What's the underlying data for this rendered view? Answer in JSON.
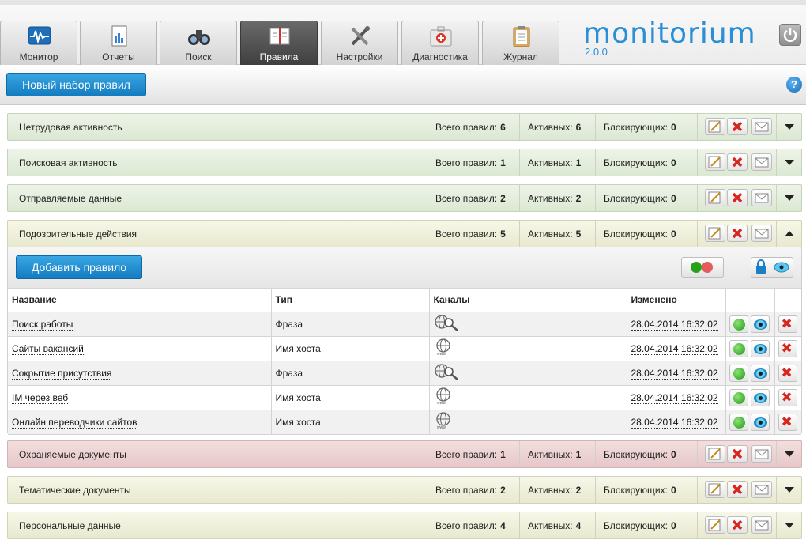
{
  "tabs": [
    {
      "label": "Монитор",
      "icon": "monitor-icon",
      "active": false
    },
    {
      "label": "Отчеты",
      "icon": "reports-icon",
      "active": false
    },
    {
      "label": "Поиск",
      "icon": "binoculars-icon",
      "active": false
    },
    {
      "label": "Правила",
      "icon": "notebook-icon",
      "active": true
    },
    {
      "label": "Настройки",
      "icon": "tools-icon",
      "active": false
    },
    {
      "label": "Диагностика",
      "icon": "firstaid-icon",
      "active": false
    },
    {
      "label": "Журнал",
      "icon": "clipboard-icon",
      "active": false
    }
  ],
  "brand": {
    "logo": "monitorium",
    "version": "2.0.0"
  },
  "toolbar": {
    "new_ruleset_label": "Новый набор правил",
    "help_label": "?"
  },
  "stats_labels": {
    "total": "Всего правил:",
    "active": "Активных:",
    "blocking": "Блокирующих:"
  },
  "rule_sets": [
    {
      "name": "Нетрудовая активность",
      "total": "6",
      "active": "6",
      "blocking": "0",
      "color": "green"
    },
    {
      "name": "Поисковая активность",
      "total": "1",
      "active": "1",
      "blocking": "0",
      "color": "green"
    },
    {
      "name": "Отправляемые данные",
      "total": "2",
      "active": "2",
      "blocking": "0",
      "color": "green"
    },
    {
      "name": "Подозрительные действия",
      "total": "5",
      "active": "5",
      "blocking": "0",
      "color": "yellow"
    },
    {
      "name": "Охраняемые документы",
      "total": "1",
      "active": "1",
      "blocking": "0",
      "color": "red"
    },
    {
      "name": "Тематические документы",
      "total": "2",
      "active": "2",
      "blocking": "0",
      "color": "yellow"
    },
    {
      "name": "Персональные данные",
      "total": "4",
      "active": "4",
      "blocking": "0",
      "color": "yellow"
    }
  ],
  "expanded": {
    "add_rule_label": "Добавить правило",
    "columns": [
      "Название",
      "Тип",
      "Каналы",
      "Изменено"
    ],
    "rules": [
      {
        "name": "Поиск работы",
        "type": "Фраза",
        "channel": "search-icon",
        "modified": "28.04.2014 16:32:02"
      },
      {
        "name": "Сайты вакансий",
        "type": "Имя хоста",
        "channel": "www-icon",
        "modified": "28.04.2014 16:32:02"
      },
      {
        "name": "Сокрытие присутствия",
        "type": "Фраза",
        "channel": "search-icon",
        "modified": "28.04.2014 16:32:02"
      },
      {
        "name": "IM через веб",
        "type": "Имя хоста",
        "channel": "www-icon",
        "modified": "28.04.2014 16:32:02"
      },
      {
        "name": "Онлайн переводчики сайтов",
        "type": "Имя хоста",
        "channel": "www-icon",
        "modified": "28.04.2014 16:32:02"
      }
    ]
  },
  "colors": {
    "accent": "#2b8fd6",
    "button_blue": "#1c87cc",
    "row_green": "#e3edda",
    "row_yellow": "#ededd7",
    "row_red": "#ebd0d1"
  }
}
